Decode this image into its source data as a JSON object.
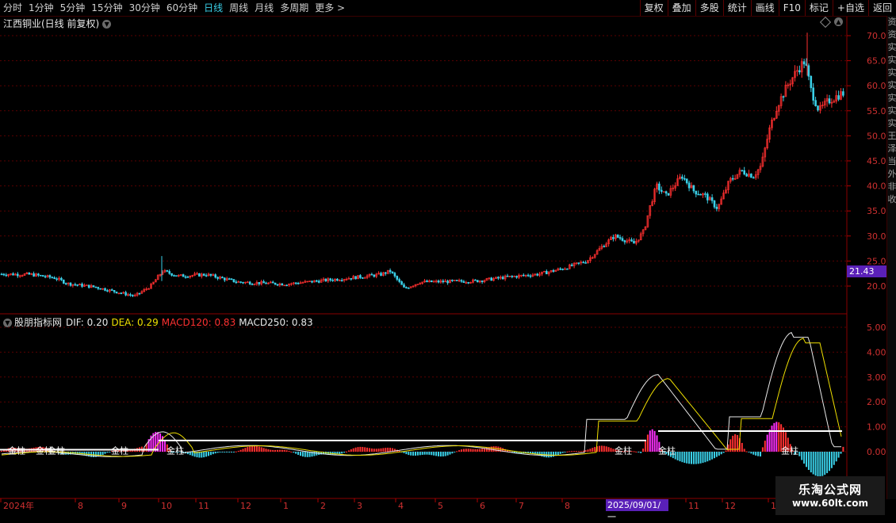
{
  "timeframes": [
    "分时",
    "1分钟",
    "5分钟",
    "15分钟",
    "30分钟",
    "60分钟",
    "日线",
    "周线",
    "月线",
    "多周期",
    "更多"
  ],
  "active_timeframe": "日线",
  "more_arrow": ">",
  "tools": [
    "复权",
    "叠加",
    "多股",
    "统计",
    "画线",
    "F10",
    "标记",
    "+自选",
    "返回"
  ],
  "stock_title": "江西铜业(日线 前复权)",
  "indicator": {
    "name": "股朋指标网",
    "dif": "DIF: 0.20",
    "dea": "DEA: 0.29",
    "macd120": "MACD120: 0.83",
    "macd250": "MACD250: 0.83"
  },
  "price_axis": [
    "70.00",
    "65.00",
    "60.00",
    "55.00",
    "50.00",
    "45.00",
    "40.00",
    "35.00",
    "30.00",
    "25.00",
    "20.00"
  ],
  "current_price": "21.43",
  "macd_axis": [
    "5.00",
    "4.00",
    "3.00",
    "2.00",
    "1.00",
    "0.00"
  ],
  "x_axis_labels": [
    "2024年",
    "8",
    "9",
    "10",
    "11",
    "12",
    "1",
    "2",
    "3",
    "4",
    "5",
    "6",
    "7",
    "8",
    "2025/09/01/一",
    "11",
    "12",
    "1"
  ],
  "signal_labels": [
    "金柱",
    "金柱",
    "金柱",
    "金柱",
    "金柱",
    "金柱",
    "金柱",
    "金柱"
  ],
  "right_scroll_chars": [
    "资",
    "资",
    "实",
    "实",
    "实",
    "实",
    "实",
    "实",
    "实",
    "王",
    "泽",
    "当",
    "外",
    "非",
    "收"
  ],
  "watermark": {
    "line1": "乐淘公式网",
    "line2": "www.60lt.com"
  },
  "colors": {
    "up": "#ff3030",
    "down": "#3ad0e8",
    "dif": "#e8e8e8",
    "dea": "#f0e000",
    "highlight": "#ff30ff",
    "accent": "#5a20b8"
  }
}
